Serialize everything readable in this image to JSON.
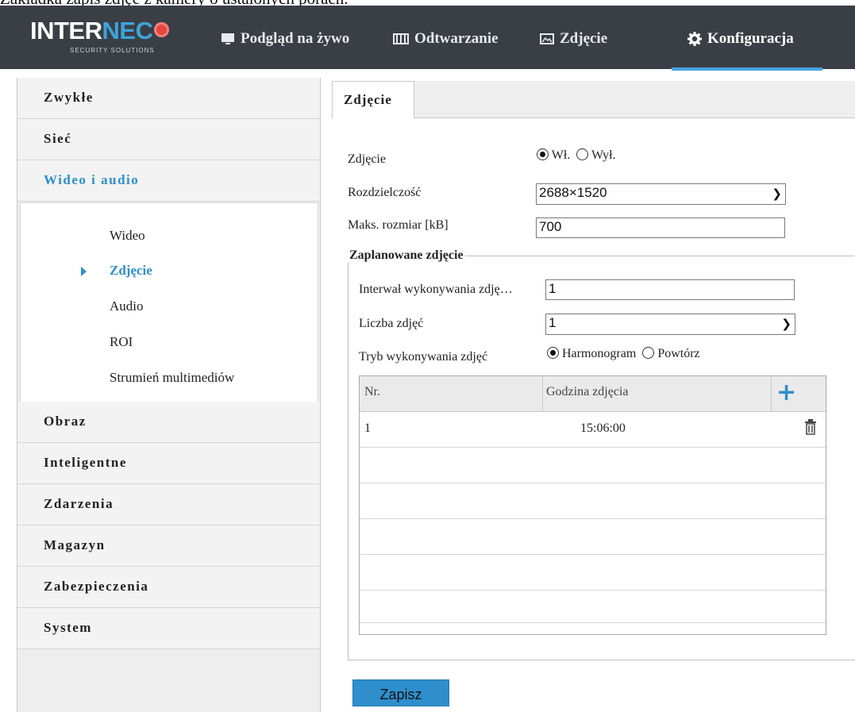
{
  "caption": "Zakładka zapis zdjęć z kamery o ustalonych porach.",
  "logo": {
    "brand_white": "INTER",
    "brand_blue": "NEC",
    "tagline": "SECURITY SOLUTIONS"
  },
  "nav": {
    "live": "Podgląd na żywo",
    "playback": "Odtwarzanie",
    "photo": "Zdjęcie",
    "config": "Konfiguracja"
  },
  "sidebar": {
    "items": [
      "Zwykłe",
      "Sieć",
      "Wideo i audio",
      "Obraz",
      "Inteligentne",
      "Zdarzenia",
      "Magazyn",
      "Zabezpieczenia",
      "System"
    ],
    "sub_items": [
      "Wideo",
      "Zdjęcie",
      "Audio",
      "ROI",
      "Strumień multimediów"
    ]
  },
  "tab": "Zdjęcie",
  "form": {
    "snapshot_label": "Zdjęcie",
    "on_label": "Wł.",
    "off_label": "Wył.",
    "resolution_label": "Rozdzielczość",
    "resolution_value": "2688×1520",
    "max_size_label": "Maks. rozmiar [kB]",
    "max_size_value": "700",
    "scheduled_legend": "Zaplanowane zdjęcie",
    "interval_label": "Interwał wykonywania zdję…",
    "interval_value": "1",
    "count_label": "Liczba zdjęć",
    "count_value": "1",
    "mode_label": "Tryb wykonywania zdjęć",
    "mode_schedule": "Harmonogram",
    "mode_repeat": "Powtórz"
  },
  "table": {
    "headers": [
      "Nr.",
      "Godzina zdjęcia"
    ],
    "rows": [
      {
        "no": "1",
        "time": "15:06:00"
      }
    ]
  },
  "save_label": "Zapisz",
  "colors": {
    "accent": "#2d8fc9",
    "header_bg": "#3a3f46"
  }
}
